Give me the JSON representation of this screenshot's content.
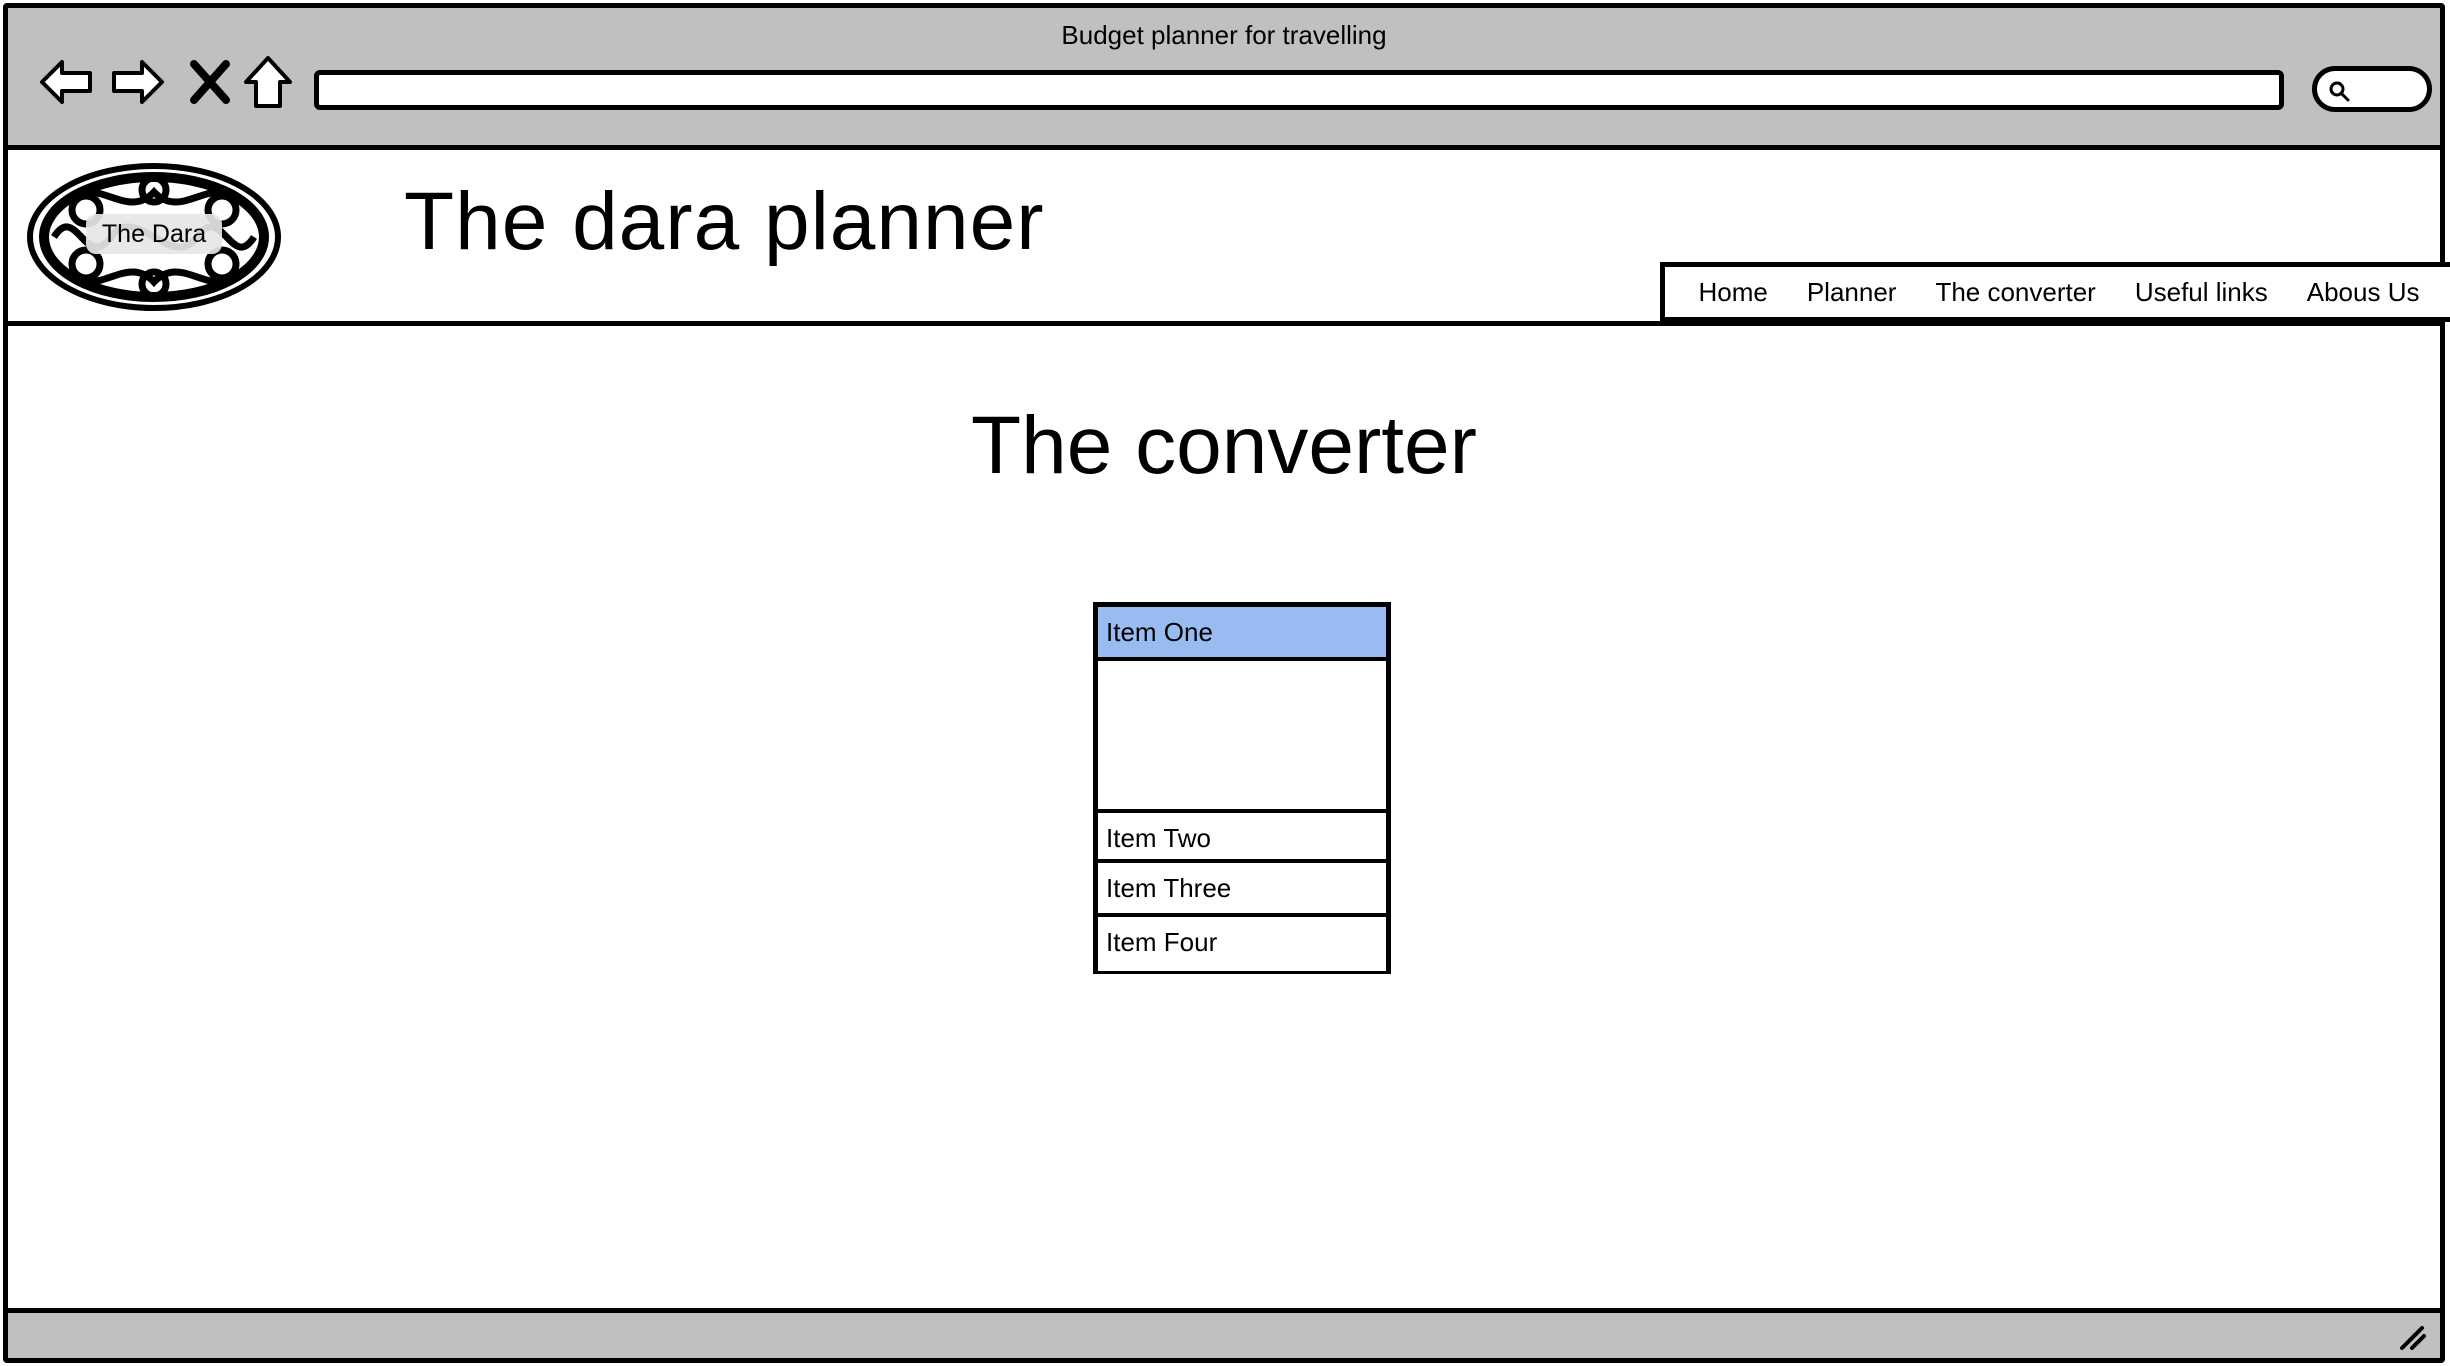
{
  "window": {
    "title": "Budget planner for travelling"
  },
  "toolbar": {
    "back_icon": "arrow-left-icon",
    "forward_icon": "arrow-right-icon",
    "stop_icon": "close-icon",
    "home_icon": "home-icon",
    "search_icon": "search-icon",
    "address_value": ""
  },
  "header": {
    "logo_text": "The Dara",
    "site_title": "The dara planner",
    "menu": [
      {
        "label": "Home"
      },
      {
        "label": "Planner"
      },
      {
        "label": "The converter"
      },
      {
        "label": "Useful links"
      },
      {
        "label": "Abous Us"
      }
    ]
  },
  "main": {
    "heading": "The converter",
    "list": {
      "items": [
        {
          "label": "Item One",
          "selected": true
        },
        {
          "label": "Item Two",
          "selected": false
        },
        {
          "label": "Item Three",
          "selected": false
        },
        {
          "label": "Item Four",
          "selected": false
        }
      ],
      "selected_color": "#98bcf2"
    }
  },
  "colors": {
    "chrome": "#c0c0c0",
    "border": "#000000",
    "background": "#ffffff"
  }
}
